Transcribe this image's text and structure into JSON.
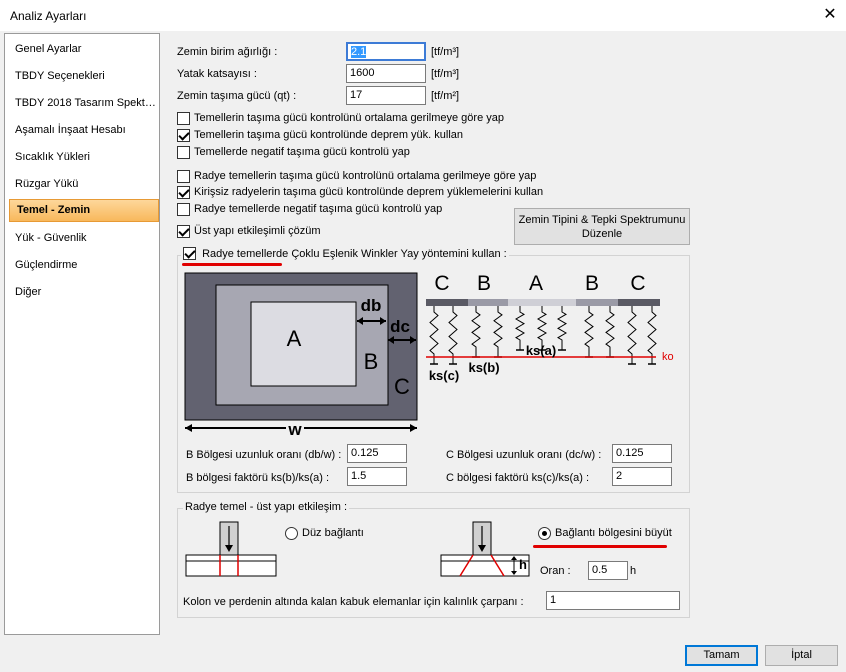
{
  "window": {
    "title": "Analiz Ayarları"
  },
  "sidebar": {
    "items": [
      {
        "label": "Genel Ayarlar",
        "active": false
      },
      {
        "label": "TBDY Seçenekleri",
        "active": false
      },
      {
        "label": "TBDY 2018 Tasarım Spekt…",
        "active": false
      },
      {
        "label": "Aşamalı İnşaat Hesabı",
        "active": false
      },
      {
        "label": "Sıcaklık Yükleri",
        "active": false
      },
      {
        "label": "Rüzgar Yükü",
        "active": false
      },
      {
        "label": "Temel - Zemin",
        "active": true
      },
      {
        "label": "Yük - Güvenlik",
        "active": false
      },
      {
        "label": "Güçlendirme",
        "active": false
      },
      {
        "label": "Diğer",
        "active": false
      }
    ]
  },
  "soil": {
    "unit_weight": {
      "label": "Zemin birim ağırlığı :",
      "value": "2.1",
      "unit": "[tf/m³]"
    },
    "bed_coeff": {
      "label": "Yatak katsayısı :",
      "value": "1600",
      "unit": "[tf/m³]"
    },
    "bearing": {
      "label": "Zemin taşıma gücü (qt) :",
      "value": "17",
      "unit": "[tf/m²]"
    }
  },
  "checks1": [
    {
      "label": "Temellerin taşıma gücü kontrolünü ortalama gerilmeye göre yap",
      "checked": false
    },
    {
      "label": "Temellerin taşıma gücü kontrolünde deprem yük. kullan",
      "checked": true
    },
    {
      "label": "Temellerde negatif taşıma gücü kontrolü yap",
      "checked": false
    }
  ],
  "checks2": [
    {
      "label": "Radye temellerin taşıma gücü kontrolünü ortalama gerilmeye göre yap",
      "checked": false
    },
    {
      "label": "Kirişsiz radyelerin taşıma gücü kontrolünde deprem yüklemelerini kullan",
      "checked": true
    },
    {
      "label": "Radye temellerde negatif taşıma gücü kontrolü yap",
      "checked": false
    }
  ],
  "interaction_check": {
    "label": "Üst yapı etkileşimli çözüm",
    "checked": true
  },
  "spectrum_button": {
    "line1": "Zemin Tipini  & Tepki Spektrumunu",
    "line2": "Düzenle"
  },
  "winkler": {
    "title": "Radye temellerde Çoklu Eşlenik Winkler Yay yöntemini kullan :",
    "checked": true,
    "diagram": {
      "zone_a": "A",
      "zone_b": "B",
      "zone_c": "C",
      "db": "db",
      "dc": "dc",
      "w": "w",
      "ksa": "ks(a)",
      "ksb": "ks(b)",
      "ksc": "ks(c)",
      "ko": "ko"
    },
    "b_ratio": {
      "label": "B Bölgesi uzunluk oranı (db/w) :",
      "value": "0.125"
    },
    "c_ratio": {
      "label": "C Bölgesi uzunluk oranı (dc/w) :",
      "value": "0.125"
    },
    "b_factor": {
      "label": "B bölgesi faktörü ks(b)/ks(a) :",
      "value": "1.5"
    },
    "c_factor": {
      "label": "C bölgesi faktörü ks(c)/ks(a) :",
      "value": "2"
    }
  },
  "raft": {
    "title": "Radye temel - üst yapı etkileşim :",
    "option1": {
      "label": "Düz bağlantı",
      "selected": false
    },
    "option2": {
      "label": "Bağlantı bölgesini büyüt",
      "selected": true
    },
    "h_label": "h",
    "ratio": {
      "label": "Oran :",
      "value": "0.5",
      "unit": "h"
    },
    "thickness": {
      "label": "Kolon ve perdenin altında kalan kabuk elemanlar için kalınlık çarpanı :",
      "value": "1"
    }
  },
  "footer": {
    "ok": "Tamam",
    "cancel": "İptal"
  },
  "colors": {
    "accent": "#0078d7",
    "red": "#e00000",
    "active_tab": "#f8b85b"
  }
}
